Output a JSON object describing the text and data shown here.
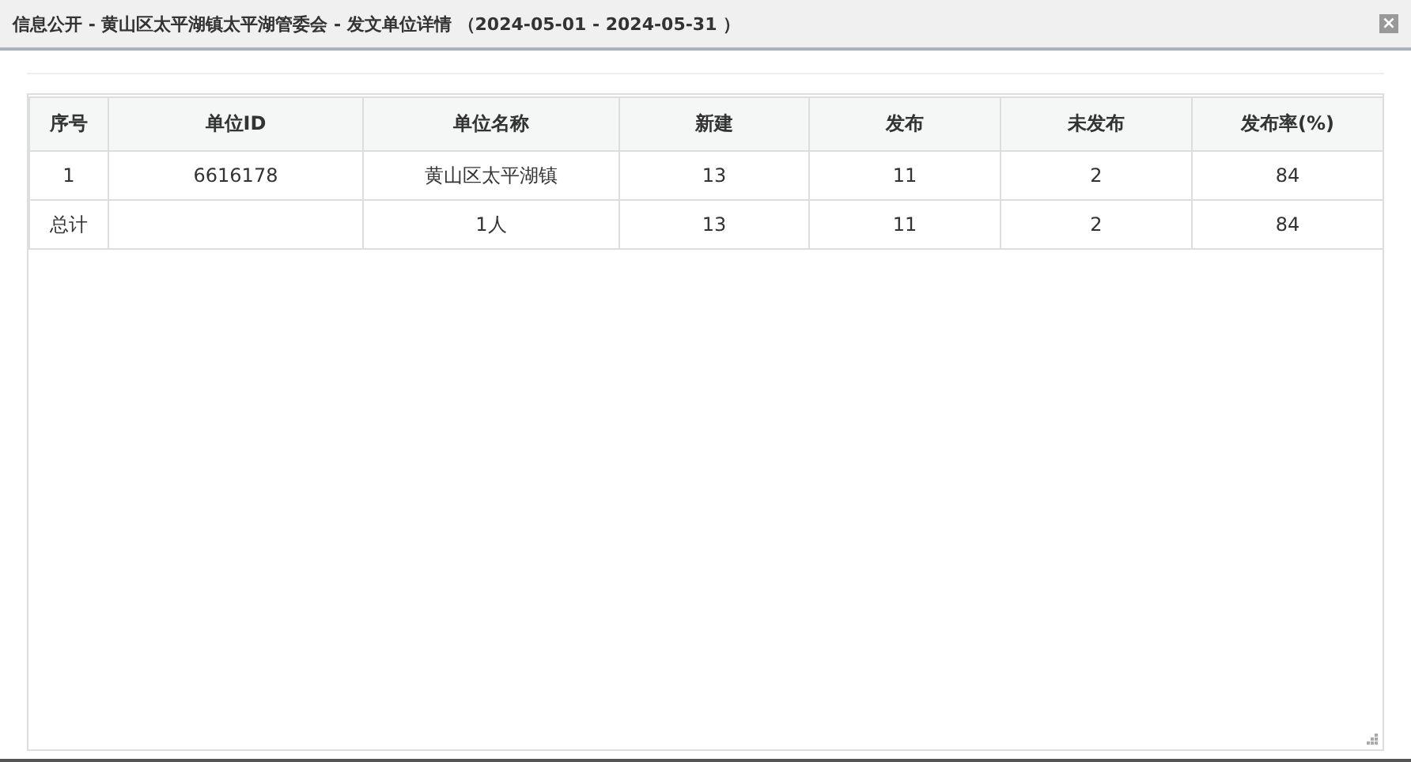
{
  "window": {
    "title": "信息公开 - 黄山区太平湖镇太平湖管委会 - 发文单位详情 （2024-05-01 - 2024-05-31 ）",
    "close": "×"
  },
  "table": {
    "columns": [
      "序号",
      "单位ID",
      "单位名称",
      "新建",
      "发布",
      "未发布",
      "发布率(%)"
    ],
    "rows": [
      [
        "1",
        "6616178",
        "黄山区太平湖镇",
        "13",
        "11",
        "2",
        "84"
      ],
      [
        "总计",
        "",
        "1人",
        "13",
        "11",
        "2",
        "84"
      ]
    ]
  }
}
